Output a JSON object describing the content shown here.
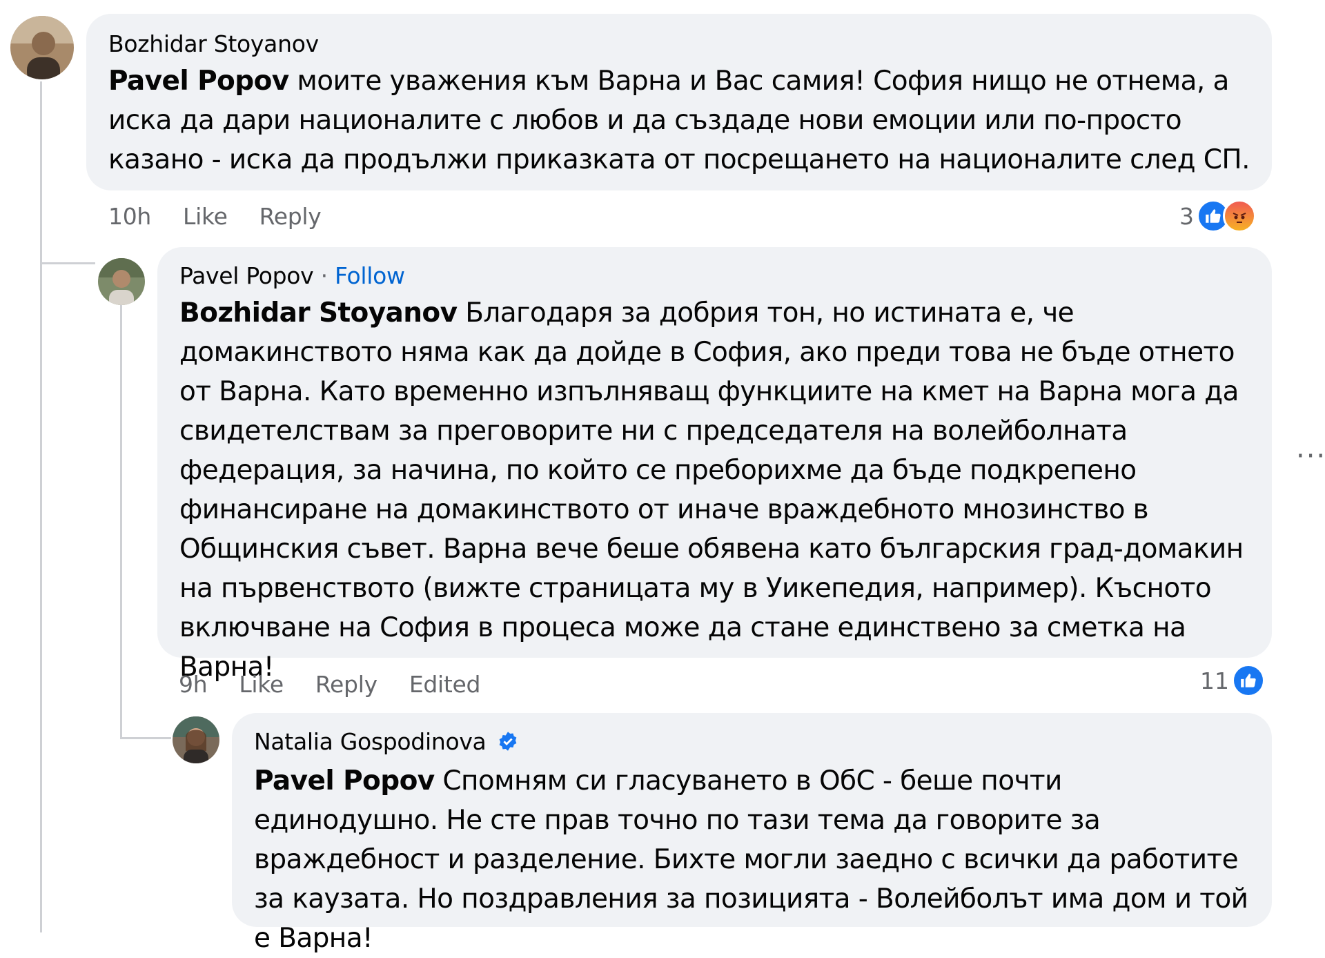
{
  "comments": [
    {
      "author": "Bozhidar Stoyanov",
      "mention": "Pavel Popov",
      "text": " моите уважения към Варна и Вас самия! София нищо не отнема, а иска да дари националите с любов и да създаде нови емоции или по-просто казано - иска да продължи приказката от посрещането на националите след СП.",
      "time": "10h",
      "like_label": "Like",
      "reply_label": "Reply",
      "reaction_count": "3"
    },
    {
      "author": "Pavel Popov",
      "follow_sep": "·",
      "follow_label": "Follow",
      "mention": "Bozhidar Stoyanov",
      "text": " Благодаря за добрия тон, но истината е, че домакинството няма как да дойде в София, ако преди това не бъде отнето от Варна. Като временно изпълняващ функциите на кмет на Варна мога да свидетелствам за преговорите ни с председателя на волейболната федерация, за начина, по който се преборихме да бъде подкрепено финансиране на домакинството от иначе враждебното мнозинство в Общинския съвет. Варна вече беше обявена като българския град-домакин на първенството (вижте страницата му в Уикепедия, например). Късното включване на София в процеса може да стане единствено за сметка на Варна!",
      "time": "9h",
      "like_label": "Like",
      "reply_label": "Reply",
      "edited_label": "Edited",
      "reaction_count": "11"
    },
    {
      "author": "Natalia Gospodinova",
      "mention": "Pavel Popov",
      "text": " Спомням си гласуването в ОбС - беше почти единодушно. Не сте прав точно по тази тема да говорите за враждебност и разделение. Бихте могли заедно с всички да работите за каузата. Но поздравления за позицията - Волейболът има дом и той е Варна!"
    }
  ],
  "more_label": "···",
  "colors": {
    "bubble": "#f0f2f5",
    "meta": "#65676b",
    "link": "#0064d1",
    "like": "#1877f2"
  }
}
